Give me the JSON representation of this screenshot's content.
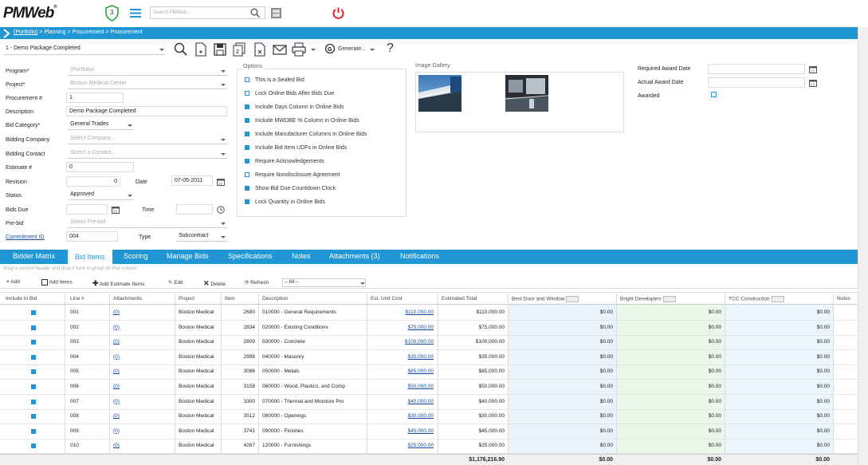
{
  "app": {
    "logo": "PMWeb",
    "logo_sup": "®",
    "shield_count": "3",
    "search_placeholder": "Search PMWeb..."
  },
  "breadcrumb": {
    "root": "(Portfolio)",
    "rest": " > Planning > Procurement > Procurement"
  },
  "toolbar": {
    "record": "1 - Demo Package Completed",
    "generate": "Generate...",
    "help": "?"
  },
  "form": {
    "program_label": "Program*",
    "program_value": "(Portfolio)",
    "project_label": "Project*",
    "project_value": "Boston Medical Center",
    "procurement_label": "Procurement #",
    "procurement_value": "1",
    "description_label": "Description",
    "description_value": "Demo Package Completed",
    "bid_category_label": "Bid Category*",
    "bid_category_value": "General Trades",
    "bidding_company_label": "Bidding Company",
    "bidding_company_placeholder": "Select Company...",
    "bidding_contact_label": "Bidding Contact",
    "bidding_contact_placeholder": "Select a Contact...",
    "estimate_label": "Estimate #",
    "estimate_value": "0",
    "revision_label": "Revision",
    "revision_value": "0",
    "date_label": "Date",
    "date_value": "07-05-2011",
    "status_label": "Status",
    "status_value": "Approved",
    "bids_due_label": "Bids Due",
    "time_label": "Time",
    "prebid_label": "Pre-bid",
    "prebid_placeholder": "Select Pre-bid",
    "commitment_label": "Commitment ID",
    "commitment_value": "004",
    "type_label": "Type",
    "type_value": "Subcontract"
  },
  "options": {
    "title": "Options",
    "items": [
      {
        "label": "This is a Sealed Bid",
        "checked": false
      },
      {
        "label": "Lock Online Bids After Bids Due",
        "checked": false
      },
      {
        "label": "Include Days Column in Online Bids",
        "checked": true
      },
      {
        "label": "Include MWDBE % Column in Online Bids",
        "checked": true
      },
      {
        "label": "Include Manufacturer Columns in Online Bids",
        "checked": true
      },
      {
        "label": "Include Bid Item UDFs in Online Bids",
        "checked": true
      },
      {
        "label": "Require Acknowledgements",
        "checked": true
      },
      {
        "label": "Require Nondisclosure Agreement",
        "checked": false
      },
      {
        "label": "Show Bid Due Countdown Clock",
        "checked": true
      },
      {
        "label": "Lock Quantity in Online Bids",
        "checked": true
      }
    ]
  },
  "gallery": {
    "title": "Image Gallery"
  },
  "award": {
    "required_label": "Required Award Date",
    "actual_label": "Actual Award Date",
    "awarded_label": "Awarded"
  },
  "tabs": [
    "Bidder Matrix",
    "Bid Items",
    "Scoring",
    "Manage Bids",
    "Specifications",
    "Notes",
    "Attachments (3)",
    "Notifications"
  ],
  "grid": {
    "group_hint": "Drag a column header and drop it here to group by that column",
    "tools": {
      "add": "Add",
      "add_items": "Add Items",
      "add_estimate": "Add Estimate Items",
      "edit": "Edit",
      "delete": "Delete",
      "refresh": "Refresh",
      "filter": "-- All --"
    },
    "headers": {
      "include": "Include In Bid",
      "line": "Line #",
      "attachments": "Attachments",
      "project": "Project",
      "item": "Item",
      "description": "Description",
      "unit_cost": "Est. Unit Cost",
      "total": "Estimated Total",
      "door": "Best Door and Window",
      "bright": "Bright Developers",
      "tcc": "TCC Construction",
      "notes": "Notes"
    },
    "rows": [
      {
        "line": "001",
        "att": "(0)",
        "project": "Boston Medical",
        "item": "2680",
        "desc": "010000 - General Requirements",
        "unit": "$110,000.00",
        "total": "$110,000.00",
        "door": "$0.00",
        "bright": "$0.00",
        "tcc": "$0.00"
      },
      {
        "line": "002",
        "att": "(0)",
        "project": "Boston Medical",
        "item": "2834",
        "desc": "020000 - Existing Conditions",
        "unit": "$75,000.00",
        "total": "$75,000.00",
        "door": "$0.00",
        "bright": "$0.00",
        "tcc": "$0.00"
      },
      {
        "line": "003",
        "att": "(0)",
        "project": "Boston Medical",
        "item": "2809",
        "desc": "030000 - Concrete",
        "unit": "$100,000.00",
        "total": "$100,000.00",
        "door": "$0.00",
        "bright": "$0.00",
        "tcc": "$0.00"
      },
      {
        "line": "004",
        "att": "(0)",
        "project": "Boston Medical",
        "item": "2998",
        "desc": "040000 - Masonry",
        "unit": "$35,000.00",
        "total": "$35,000.00",
        "door": "$0.00",
        "bright": "$0.00",
        "tcc": "$0.00"
      },
      {
        "line": "005",
        "att": "(0)",
        "project": "Boston Medical",
        "item": "3086",
        "desc": "050000 - Metals",
        "unit": "$85,000.00",
        "total": "$85,000.00",
        "door": "$0.00",
        "bright": "$0.00",
        "tcc": "$0.00"
      },
      {
        "line": "006",
        "att": "(0)",
        "project": "Boston Medical",
        "item": "3158",
        "desc": "060000 - Wood, Plastics, and Comp",
        "unit": "$50,000.00",
        "total": "$50,000.00",
        "door": "$0.00",
        "bright": "$0.00",
        "tcc": "$0.00"
      },
      {
        "line": "007",
        "att": "(0)",
        "project": "Boston Medical",
        "item": "3300",
        "desc": "070000 - Thermal and Moisture Pro",
        "unit": "$40,000.00",
        "total": "$40,000.00",
        "door": "$0.00",
        "bright": "$0.00",
        "tcc": "$0.00"
      },
      {
        "line": "008",
        "att": "(0)",
        "project": "Boston Medical",
        "item": "3512",
        "desc": "080000 - Openings",
        "unit": "$30,000.00",
        "total": "$30,000.00",
        "door": "$0.00",
        "bright": "$0.00",
        "tcc": "$0.00"
      },
      {
        "line": "009",
        "att": "(0)",
        "project": "Boston Medical",
        "item": "3741",
        "desc": "090000 - Finishes",
        "unit": "$45,000.00",
        "total": "$45,000.00",
        "door": "$0.00",
        "bright": "$0.00",
        "tcc": "$0.00"
      },
      {
        "line": "010",
        "att": "(0)",
        "project": "Boston Medical",
        "item": "4267",
        "desc": "120000 - Furnishings",
        "unit": "$25,000.00",
        "total": "$25,000.00",
        "door": "$0.00",
        "bright": "$0.00",
        "tcc": "$0.00"
      }
    ],
    "footer": {
      "total": "$1,176,216.90",
      "door": "$0.00",
      "bright": "$0.00",
      "tcc": "$0.00"
    }
  },
  "colors": {
    "accent": "#2196d4",
    "power": "#e02020",
    "shield": "#2e9e3e"
  }
}
